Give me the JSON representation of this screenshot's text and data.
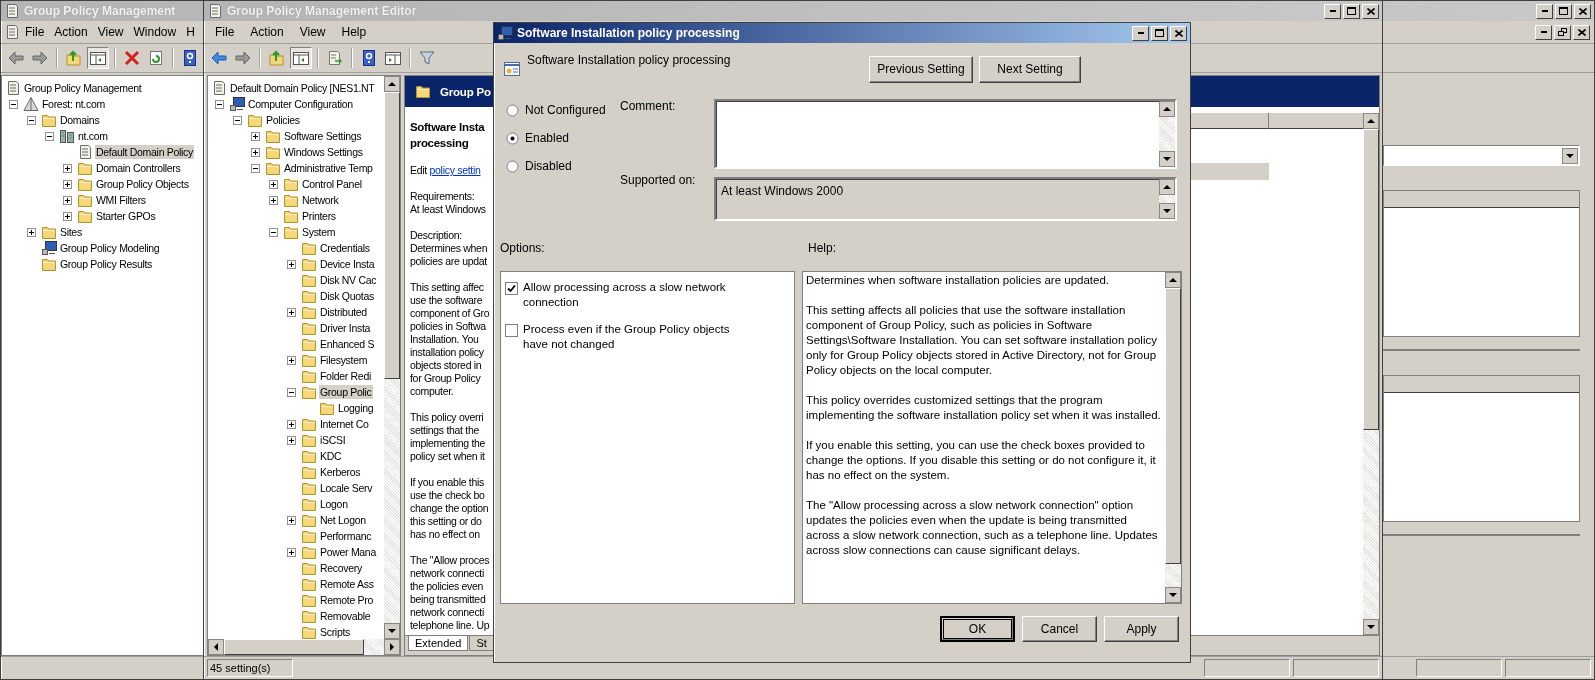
{
  "main_window": {
    "title": "Group Policy Management",
    "menu": [
      "File",
      "Action",
      "View",
      "Window",
      "H"
    ],
    "tree": [
      {
        "label": "Group Policy Management",
        "kind": "document",
        "selected": false,
        "children": [
          {
            "label": "Forest: nt.com",
            "kind": "pyramid",
            "expanded": true,
            "selected": false,
            "children": [
              {
                "label": "Domains",
                "kind": "folder",
                "expanded": true,
                "selected": false,
                "children": [
                  {
                    "label": "nt.com",
                    "kind": "server",
                    "expanded": true,
                    "selected": false,
                    "children": [
                      {
                        "label": "Default Domain Policy",
                        "kind": "document",
                        "selected": true
                      },
                      {
                        "label": "Domain Controllers",
                        "kind": "folder",
                        "expanded": false,
                        "selected": false
                      },
                      {
                        "label": "Group Policy Objects",
                        "kind": "folder",
                        "expanded": false,
                        "selected": false
                      },
                      {
                        "label": "WMI Filters",
                        "kind": "folder",
                        "expanded": false,
                        "selected": false
                      },
                      {
                        "label": "Starter GPOs",
                        "kind": "folder",
                        "expanded": false,
                        "selected": false
                      }
                    ]
                  }
                ]
              },
              {
                "label": "Sites",
                "kind": "folder",
                "expanded": false,
                "selected": false
              },
              {
                "label": "Group Policy Modeling",
                "kind": "monitor",
                "selected": false
              },
              {
                "label": "Group Policy Results",
                "kind": "folder",
                "selected": false
              }
            ]
          }
        ]
      }
    ]
  },
  "editor_window": {
    "title": "Group Policy Management Editor",
    "menu": [
      "File",
      "Action",
      "View",
      "Help"
    ],
    "tree": [
      {
        "label": "Default Domain Policy [NES1.NT",
        "kind": "document",
        "selected": false,
        "children": [
          {
            "label": "Computer Configuration",
            "kind": "monitor",
            "expanded": true,
            "selected": false,
            "children": [
              {
                "label": "Policies",
                "kind": "folder",
                "expanded": true,
                "selected": false,
                "children": [
                  {
                    "label": "Software Settings",
                    "kind": "folder",
                    "expanded": false,
                    "selected": false
                  },
                  {
                    "label": "Windows Settings",
                    "kind": "folder",
                    "expanded": false,
                    "selected": false
                  },
                  {
                    "label": "Administrative Temp",
                    "kind": "folder",
                    "expanded": true,
                    "selected": false,
                    "children": [
                      {
                        "label": "Control Panel",
                        "kind": "folder",
                        "expanded": false,
                        "selected": false
                      },
                      {
                        "label": "Network",
                        "kind": "folder",
                        "expanded": false,
                        "selected": false
                      },
                      {
                        "label": "Printers",
                        "kind": "folder",
                        "selected": false
                      },
                      {
                        "label": "System",
                        "kind": "folder",
                        "expanded": true,
                        "selected": false,
                        "children": [
                          {
                            "label": "Credentials",
                            "kind": "folder",
                            "selected": false
                          },
                          {
                            "label": "Device Insta",
                            "kind": "folder",
                            "expanded": false,
                            "selected": false
                          },
                          {
                            "label": "Disk NV Cac",
                            "kind": "folder",
                            "selected": false
                          },
                          {
                            "label": "Disk Quotas",
                            "kind": "folder",
                            "selected": false
                          },
                          {
                            "label": "Distributed",
                            "kind": "folder",
                            "expanded": false,
                            "selected": false
                          },
                          {
                            "label": "Driver Insta",
                            "kind": "folder",
                            "selected": false
                          },
                          {
                            "label": "Enhanced S",
                            "kind": "folder",
                            "selected": false
                          },
                          {
                            "label": "Filesystem",
                            "kind": "folder",
                            "expanded": false,
                            "selected": false
                          },
                          {
                            "label": "Folder Redi",
                            "kind": "folder",
                            "selected": false
                          },
                          {
                            "label": "Group Polic",
                            "kind": "folder",
                            "expanded": true,
                            "selected": true,
                            "children": [
                              {
                                "label": "Logging",
                                "kind": "folder",
                                "selected": false
                              }
                            ]
                          },
                          {
                            "label": "Internet Co",
                            "kind": "folder",
                            "expanded": false,
                            "selected": false
                          },
                          {
                            "label": "iSCSI",
                            "kind": "folder",
                            "expanded": false,
                            "selected": false
                          },
                          {
                            "label": "KDC",
                            "kind": "folder",
                            "selected": false
                          },
                          {
                            "label": "Kerberos",
                            "kind": "folder",
                            "selected": false
                          },
                          {
                            "label": "Locale Serv",
                            "kind": "folder",
                            "selected": false
                          },
                          {
                            "label": "Logon",
                            "kind": "folder",
                            "selected": false
                          },
                          {
                            "label": "Net Logon",
                            "kind": "folder",
                            "expanded": false,
                            "selected": false
                          },
                          {
                            "label": "Performanc",
                            "kind": "folder",
                            "selected": false
                          },
                          {
                            "label": "Power Mana",
                            "kind": "folder",
                            "expanded": false,
                            "selected": false
                          },
                          {
                            "label": "Recovery",
                            "kind": "folder",
                            "selected": false
                          },
                          {
                            "label": "Remote Ass",
                            "kind": "folder",
                            "selected": false
                          },
                          {
                            "label": "Remote Pro",
                            "kind": "folder",
                            "selected": false
                          },
                          {
                            "label": "Removable",
                            "kind": "folder",
                            "selected": false
                          },
                          {
                            "label": "Scripts",
                            "kind": "folder",
                            "selected": false
                          }
                        ]
                      }
                    ]
                  }
                ]
              }
            ]
          }
        ]
      }
    ],
    "details": {
      "header": "Group Po",
      "title_lines": [
        "Software Insta",
        "processing"
      ],
      "edit_text": "Edit",
      "edit_link": "policy settin",
      "blocks": [
        [
          "Requirements:",
          "At least Windows"
        ],
        [
          "Description:",
          "Determines when",
          "policies are updat"
        ],
        [
          "This setting affec",
          "use the software",
          "component of Gro",
          "policies in Softwa",
          "Installation. You",
          "installation policy",
          "objects stored in",
          "for Group Policy",
          "computer."
        ],
        [
          "This policy overri",
          "settings that the",
          "implementing the",
          "policy set when it"
        ],
        [
          "If you enable this",
          "use the check bo",
          "change the option",
          "this setting or do",
          "has no effect on"
        ],
        [
          "The \"Allow proces",
          "network connecti",
          "the policies even",
          "being transmitted",
          "network connecti",
          "telephone line. Up"
        ]
      ]
    },
    "tabs": [
      {
        "label": "Extended",
        "selected": true
      },
      {
        "label": "St",
        "selected": false
      }
    ],
    "status": "45 setting(s)"
  },
  "dialog": {
    "title": "Software Installation policy processing",
    "heading": "Software Installation policy processing",
    "nav_buttons": [
      "Previous Setting",
      "Next Setting"
    ],
    "states": [
      {
        "label": "Not Configured",
        "selected": false
      },
      {
        "label": "Enabled",
        "selected": true
      },
      {
        "label": "Disabled",
        "selected": false
      }
    ],
    "comment_label": "Comment:",
    "supported_label": "Supported on:",
    "supported_value": "At least Windows 2000",
    "options_label": "Options:",
    "help_label": "Help:",
    "options": [
      {
        "label": "Allow processing across a slow network connection",
        "checked": true
      },
      {
        "label": "Process even if the Group Policy objects have not changed",
        "checked": false
      }
    ],
    "help": [
      "Determines when software installation policies are updated.",
      "This setting affects all policies that use the software installation component of Group Policy, such as policies in Software Settings\\Software Installation. You can set software installation policy only for Group Policy objects stored in Active Directory, not for Group Policy objects on the local computer.",
      "This policy overrides customized settings that the program implementing the software installation policy set when it was installed.",
      "If you enable this setting, you can use the check boxes provided to change the options. If you disable this setting or do not configure it, it has no effect on the system.",
      "The \"Allow processing across a slow network connection\" option updates the policies even when the update is being transmitted across a slow network connection, such as a telephone line. Updates across slow connections can cause significant delays."
    ],
    "buttons": [
      "OK",
      "Cancel",
      "Apply"
    ]
  }
}
